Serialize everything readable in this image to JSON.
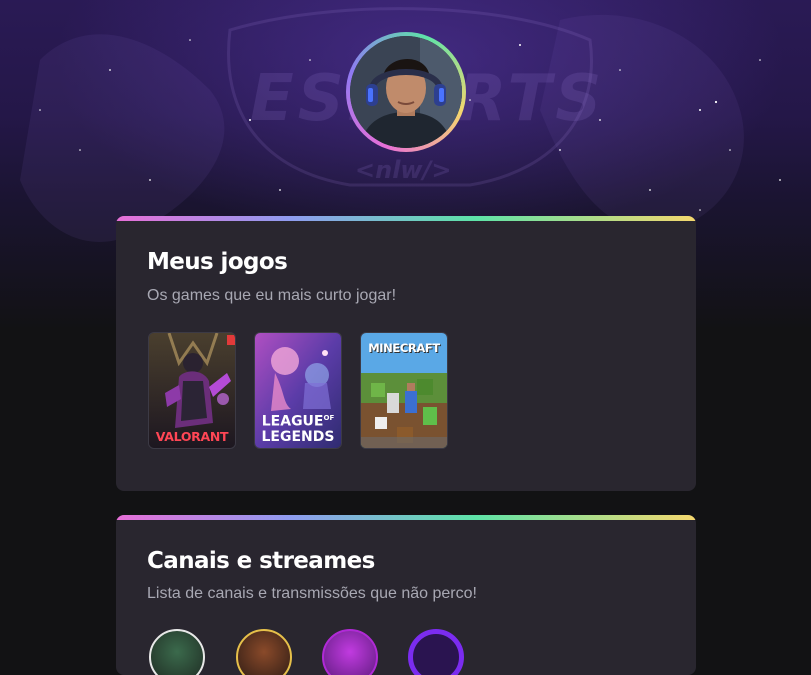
{
  "profile": {
    "avatar_alt": "avatar"
  },
  "games_card": {
    "title": "Meus jogos",
    "subtitle": "Os games que eu mais curto jogar!",
    "games": [
      {
        "name": "VALORANT",
        "icon": "valorant-cover"
      },
      {
        "name": "LEAGUE OF LEGENDS",
        "line1": "LEAGUE",
        "of": "OF",
        "line2": "LEGENDS",
        "icon": "league-of-legends-cover"
      },
      {
        "name": "MINECRAFT",
        "icon": "minecraft-cover"
      }
    ]
  },
  "channels_card": {
    "title": "Canais e streames",
    "subtitle": "Lista de canais e transmissões que não perco!"
  },
  "colors": {
    "accent_gradient": [
      "#e76fd7",
      "#8f9cf0",
      "#5ee3a8",
      "#f5d76e"
    ],
    "card_bg": "#29262f",
    "page_bg": "#121214"
  }
}
